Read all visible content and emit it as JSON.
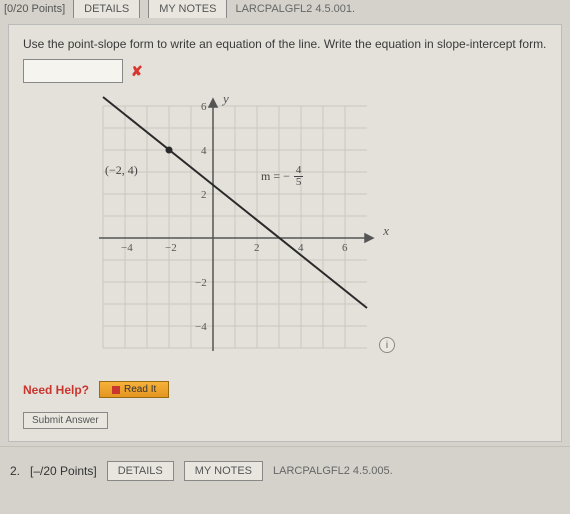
{
  "top": {
    "points_label": "[0/20 Points]",
    "details_btn": "DETAILS",
    "notes_btn": "MY NOTES",
    "ref": "LARCPALGFL2 4.5.001."
  },
  "question": {
    "prompt": "Use the point-slope form to write an equation of the line. Write the equation in slope-intercept form.",
    "answer_value": "",
    "wrong_mark": "✘"
  },
  "graph": {
    "y_axis": "y",
    "x_axis": "x",
    "point_label": "(−2, 4)",
    "slope_prefix": "m = −",
    "slope_num": "4",
    "slope_den": "5",
    "ticks_x": {
      "n4": "−4",
      "n2": "−2",
      "p2": "2",
      "p4": "4",
      "p6": "6"
    },
    "ticks_y": {
      "p6": "6",
      "p4": "4",
      "p2": "2",
      "n2": "−2",
      "n4": "−4"
    },
    "info": "i"
  },
  "help": {
    "label": "Need Help?",
    "read_it": "Read It"
  },
  "submit": {
    "label": "Submit Answer"
  },
  "next": {
    "num": "2.",
    "points": "[–/20 Points]",
    "details_btn": "DETAILS",
    "notes_btn": "MY NOTES",
    "ref": "LARCPALGFL2 4.5.005."
  },
  "chart_data": {
    "type": "line",
    "title": "",
    "xlabel": "x",
    "ylabel": "y",
    "xlim": [
      -5,
      7
    ],
    "ylim": [
      -5,
      7
    ],
    "x_ticks": [
      -4,
      -2,
      2,
      4,
      6
    ],
    "y_ticks": [
      -4,
      -2,
      2,
      4,
      6
    ],
    "point": {
      "x": -2,
      "y": 4,
      "label": "(−2, 4)"
    },
    "slope": -0.8,
    "slope_label": "m = -4/5",
    "line_points": [
      {
        "x": -5,
        "y": 6.4
      },
      {
        "x": 7,
        "y": -3.2
      }
    ]
  }
}
